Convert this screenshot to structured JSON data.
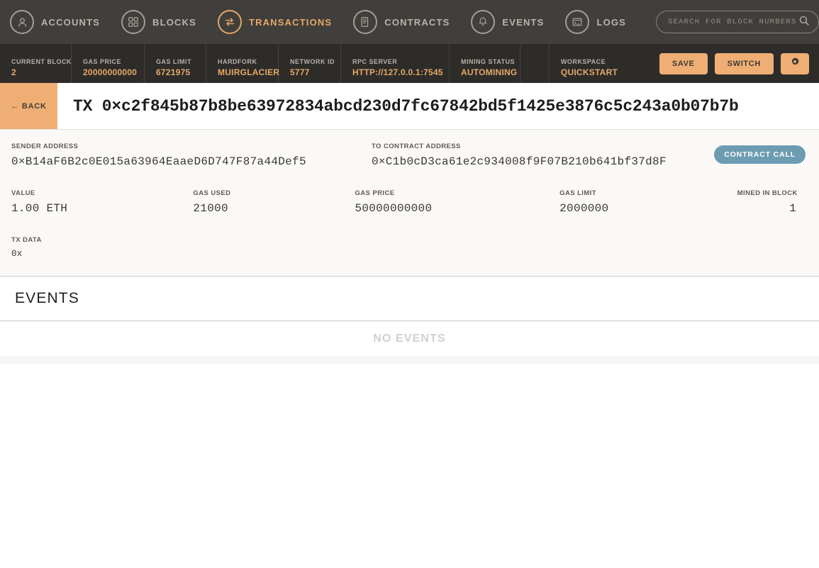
{
  "nav": {
    "items": [
      {
        "label": "ACCOUNTS",
        "icon": "user-icon",
        "active": false
      },
      {
        "label": "BLOCKS",
        "icon": "grid-icon",
        "active": false
      },
      {
        "label": "TRANSACTIONS",
        "icon": "transactions-arrows-icon",
        "active": true
      },
      {
        "label": "CONTRACTS",
        "icon": "document-icon",
        "active": false
      },
      {
        "label": "EVENTS",
        "icon": "bell-icon",
        "active": false
      },
      {
        "label": "LOGS",
        "icon": "terminal-icon",
        "active": false
      }
    ],
    "search_placeholder": "SEARCH FOR BLOCK NUMBERS OR TX HASHES",
    "search_value": "",
    "search_icon": "magnifier-icon"
  },
  "status": {
    "current_block": {
      "label": "CURRENT BLOCK",
      "value": "2"
    },
    "gas_price": {
      "label": "GAS PRICE",
      "value": "20000000000"
    },
    "gas_limit": {
      "label": "GAS LIMIT",
      "value": "6721975"
    },
    "hardfork": {
      "label": "HARDFORK",
      "value": "MUIRGLACIER"
    },
    "network_id": {
      "label": "NETWORK ID",
      "value": "5777"
    },
    "rpc_server": {
      "label": "RPC SERVER",
      "value": "HTTP://127.0.0.1:7545"
    },
    "mining_status": {
      "label": "MINING STATUS",
      "value": "AUTOMINING"
    },
    "workspace": {
      "label": "WORKSPACE",
      "value": "QUICKSTART"
    },
    "save_label": "SAVE",
    "switch_label": "SWITCH",
    "settings_icon": "gear-icon"
  },
  "tx": {
    "back_label": "← BACK",
    "title": "TX 0×c2f845b87b8be63972834abcd230d7fc67842bd5f1425e3876c5c243a0b07b7b",
    "sender_label": "SENDER ADDRESS",
    "sender_value": "0×B14aF6B2c0E015a63964EaaeD6D747F87a44Def5",
    "to_label": "TO CONTRACT ADDRESS",
    "to_value": "0×C1b0cD3ca61e2c934008f9F07B210b641bf37d8F",
    "badge": "CONTRACT CALL",
    "value_label": "VALUE",
    "value_value": "1.00 ETH",
    "gas_used_label": "GAS USED",
    "gas_used_value": "21000",
    "gas_price_label": "GAS PRICE",
    "gas_price_value": "50000000000",
    "gas_limit_label": "GAS LIMIT",
    "gas_limit_value": "2000000",
    "mined_in_block_label": "MINED IN BLOCK",
    "mined_in_block_value": "1",
    "tx_data_label": "TX DATA",
    "tx_data_value": "0x"
  },
  "events": {
    "title": "EVENTS",
    "empty_message": "NO EVENTS"
  },
  "colors": {
    "nav_bg": "#413F3B",
    "status_bg": "#2E2C29",
    "accent_orange": "#E3A869",
    "button_orange": "#EFAF74",
    "badge_blue": "#6C9CB2",
    "panel_bg": "#FAF9F7"
  }
}
